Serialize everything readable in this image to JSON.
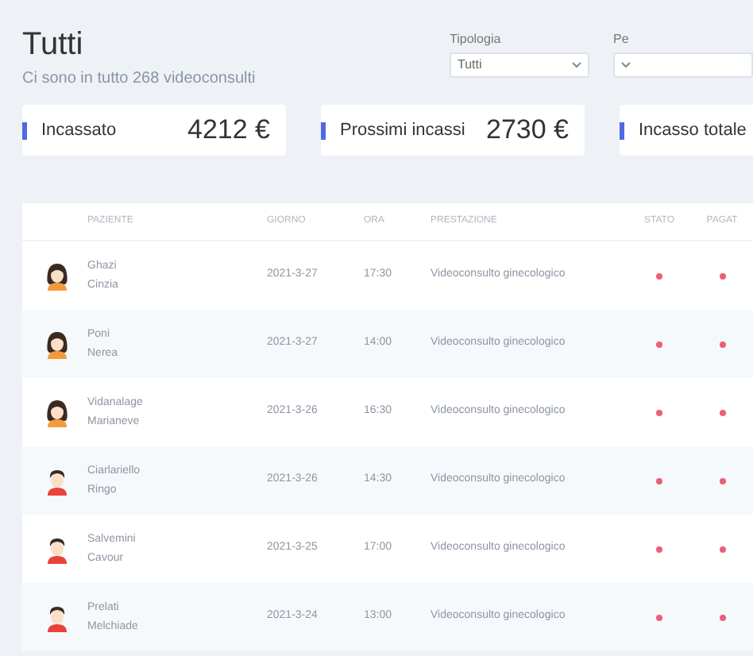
{
  "header": {
    "title": "Tutti",
    "subtitle": "Ci sono in tutto 268 videoconsulti"
  },
  "filters": [
    {
      "label": "Tipologia",
      "value": "Tutti"
    },
    {
      "label": "Pe"
    }
  ],
  "summary_cards": [
    {
      "label": "Incassato",
      "value": "4212 €"
    },
    {
      "label": "Prossimi incassi",
      "value": "2730 €"
    },
    {
      "label": "Incasso totale"
    }
  ],
  "table": {
    "columns": [
      "PAZIENTE",
      "GIORNO",
      "ORA",
      "PRESTAZIONE",
      "STATO",
      "PAGAT"
    ],
    "rows": [
      {
        "kind": "female",
        "surname": "Ghazi",
        "name": "Cinzia",
        "day": "2021-3-27",
        "time": "17:30",
        "service": "Videoconsulto ginecologico",
        "status": {
          "color": "#e8607a"
        },
        "paid": {
          "color": "#e8607a"
        }
      },
      {
        "kind": "female",
        "surname": "Poni",
        "name": "Nerea",
        "day": "2021-3-27",
        "time": "14:00",
        "service": "Videoconsulto ginecologico",
        "status": {
          "color": "#e8607a"
        },
        "paid": {
          "color": "#e8607a"
        }
      },
      {
        "kind": "female",
        "surname": "Vidanalage",
        "name": "Marianeve",
        "day": "2021-3-26",
        "time": "16:30",
        "service": "Videoconsulto ginecologico",
        "status": {
          "color": "#e8607a"
        },
        "paid": {
          "color": "#e8607a"
        }
      },
      {
        "kind": "male",
        "surname": "Ciarlariello",
        "name": "Ringo",
        "day": "2021-3-26",
        "time": "14:30",
        "service": "Videoconsulto ginecologico",
        "status": {
          "color": "#e8607a"
        },
        "paid": {
          "color": "#e8607a"
        }
      },
      {
        "kind": "male",
        "surname": "Salvemini",
        "name": "Cavour",
        "day": "2021-3-25",
        "time": "17:00",
        "service": "Videoconsulto ginecologico",
        "status": {
          "color": "#e8607a"
        },
        "paid": {
          "color": "#e8607a"
        }
      },
      {
        "kind": "male",
        "surname": "Prelati",
        "name": "Melchiade",
        "day": "2021-3-24",
        "time": "13:00",
        "service": "Videoconsulto ginecologico",
        "status": {
          "color": "#e8607a"
        },
        "paid": {
          "color": "#e8607a"
        }
      }
    ]
  }
}
